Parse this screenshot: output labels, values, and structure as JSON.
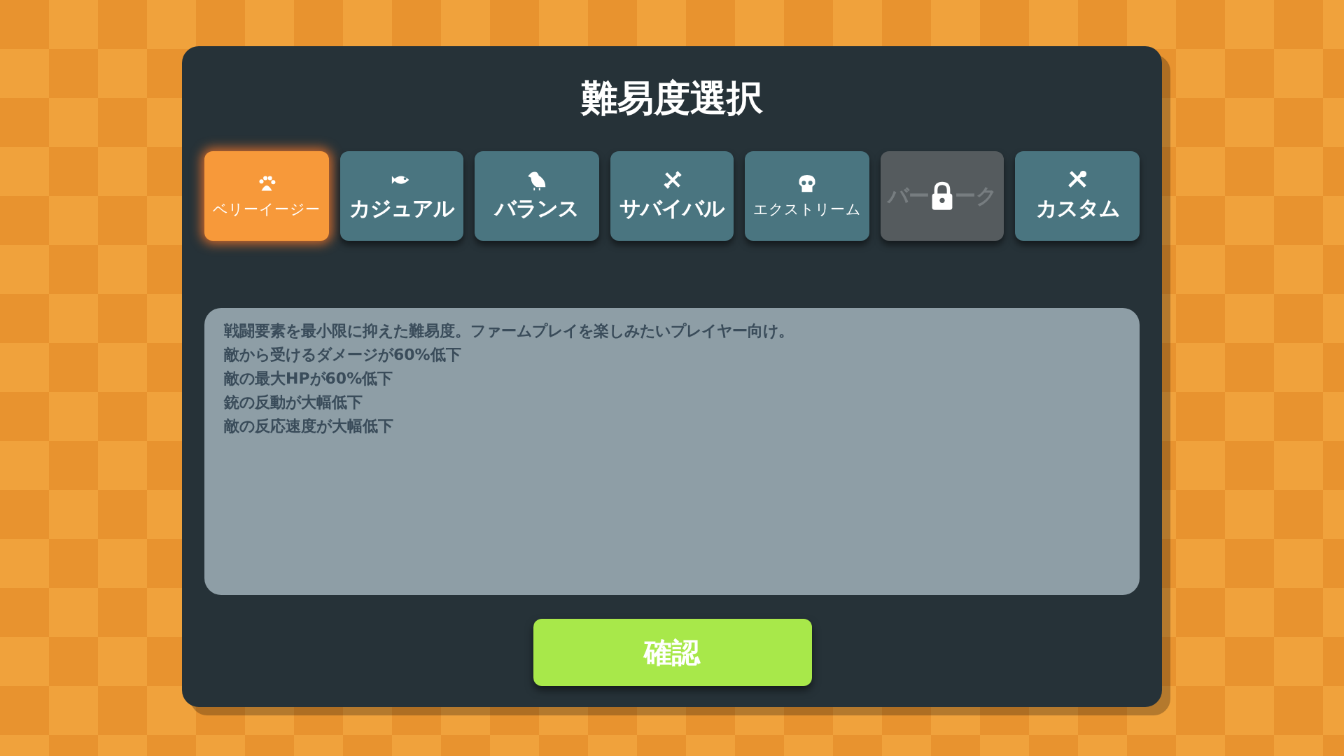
{
  "dialog": {
    "title": "難易度選択"
  },
  "tabs": [
    {
      "kind": "paw",
      "label": "ベリーイージー",
      "selected": true,
      "locked": false
    },
    {
      "kind": "fish",
      "label": "カジュアル",
      "selected": false,
      "locked": false
    },
    {
      "kind": "bird",
      "label": "バランス",
      "selected": false,
      "locked": false
    },
    {
      "kind": "swords",
      "label": "サバイバル",
      "selected": false,
      "locked": false
    },
    {
      "kind": "skull",
      "label": "エクストリーム",
      "selected": false,
      "locked": false
    },
    {
      "label_start": "バー",
      "label_end": "ーク",
      "selected": false,
      "locked": true
    },
    {
      "kind": "tools",
      "label": "カスタム",
      "selected": false,
      "locked": false
    }
  ],
  "description": [
    "戦闘要素を最小限に抑えた難易度。ファームプレイを楽しみたいプレイヤー向け。",
    "敵から受けるダメージが60%低下",
    "敵の最大HPが60%低下",
    "銃の反動が大幅低下",
    "敵の反応速度が大幅低下"
  ],
  "confirm_button": "確認"
}
